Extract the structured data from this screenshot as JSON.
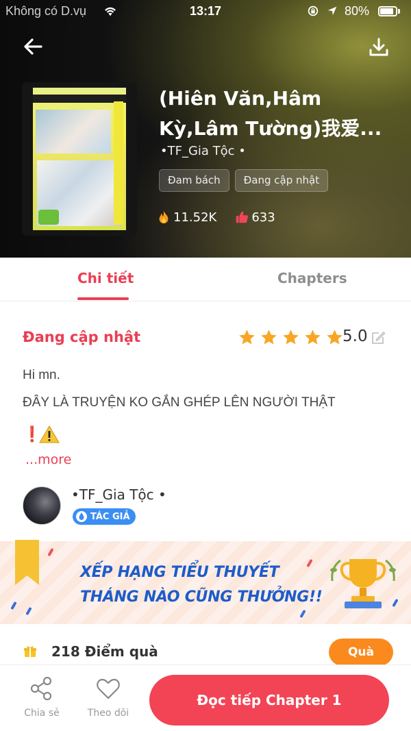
{
  "status_bar": {
    "carrier": "Không có D.vụ",
    "time": "13:17",
    "battery": "80%"
  },
  "header": {
    "title_line1": "(Hiên Văn,Hâm",
    "title_line2": "Kỳ,Lâm Tường)我爱...",
    "author": "•TF_Gia Tộc •",
    "tags": [
      "Đam bách",
      "Đang cập nhật"
    ],
    "views": "11.52K",
    "likes": "633"
  },
  "tabs": {
    "detail": "Chi tiết",
    "chapters": "Chapters",
    "active": "detail"
  },
  "detail": {
    "status": "Đang cập nhật",
    "rating": "5.0",
    "stars": 5,
    "description_line1": "Hi mn.",
    "description_line2": "ĐÂY LÀ TRUYỆN KO GẮN GHÉP LÊN NGƯỜI THẬT",
    "description_line3_warning": "❗",
    "more": "...more"
  },
  "author_block": {
    "name": "•TF_Gia Tộc •",
    "badge": "TÁC GIẢ"
  },
  "banner": {
    "line1": "XẾP HẠNG TIỂU THUYẾT",
    "line2": "THÁNG NÀO CŨNG THƯỞNG!!"
  },
  "gift": {
    "points_text": "218 Điểm quà",
    "button": "Quà"
  },
  "bottom_bar": {
    "share_label": "Chia sẻ",
    "follow_label": "Theo dõi",
    "read_label": "Đọc tiếp Chapter 1"
  },
  "colors": {
    "accent": "#ea3e53",
    "star": "#f8a623",
    "banner_text": "#1e5cc8",
    "gift_button": "#fb8a1e",
    "read_button": "#f24455"
  }
}
